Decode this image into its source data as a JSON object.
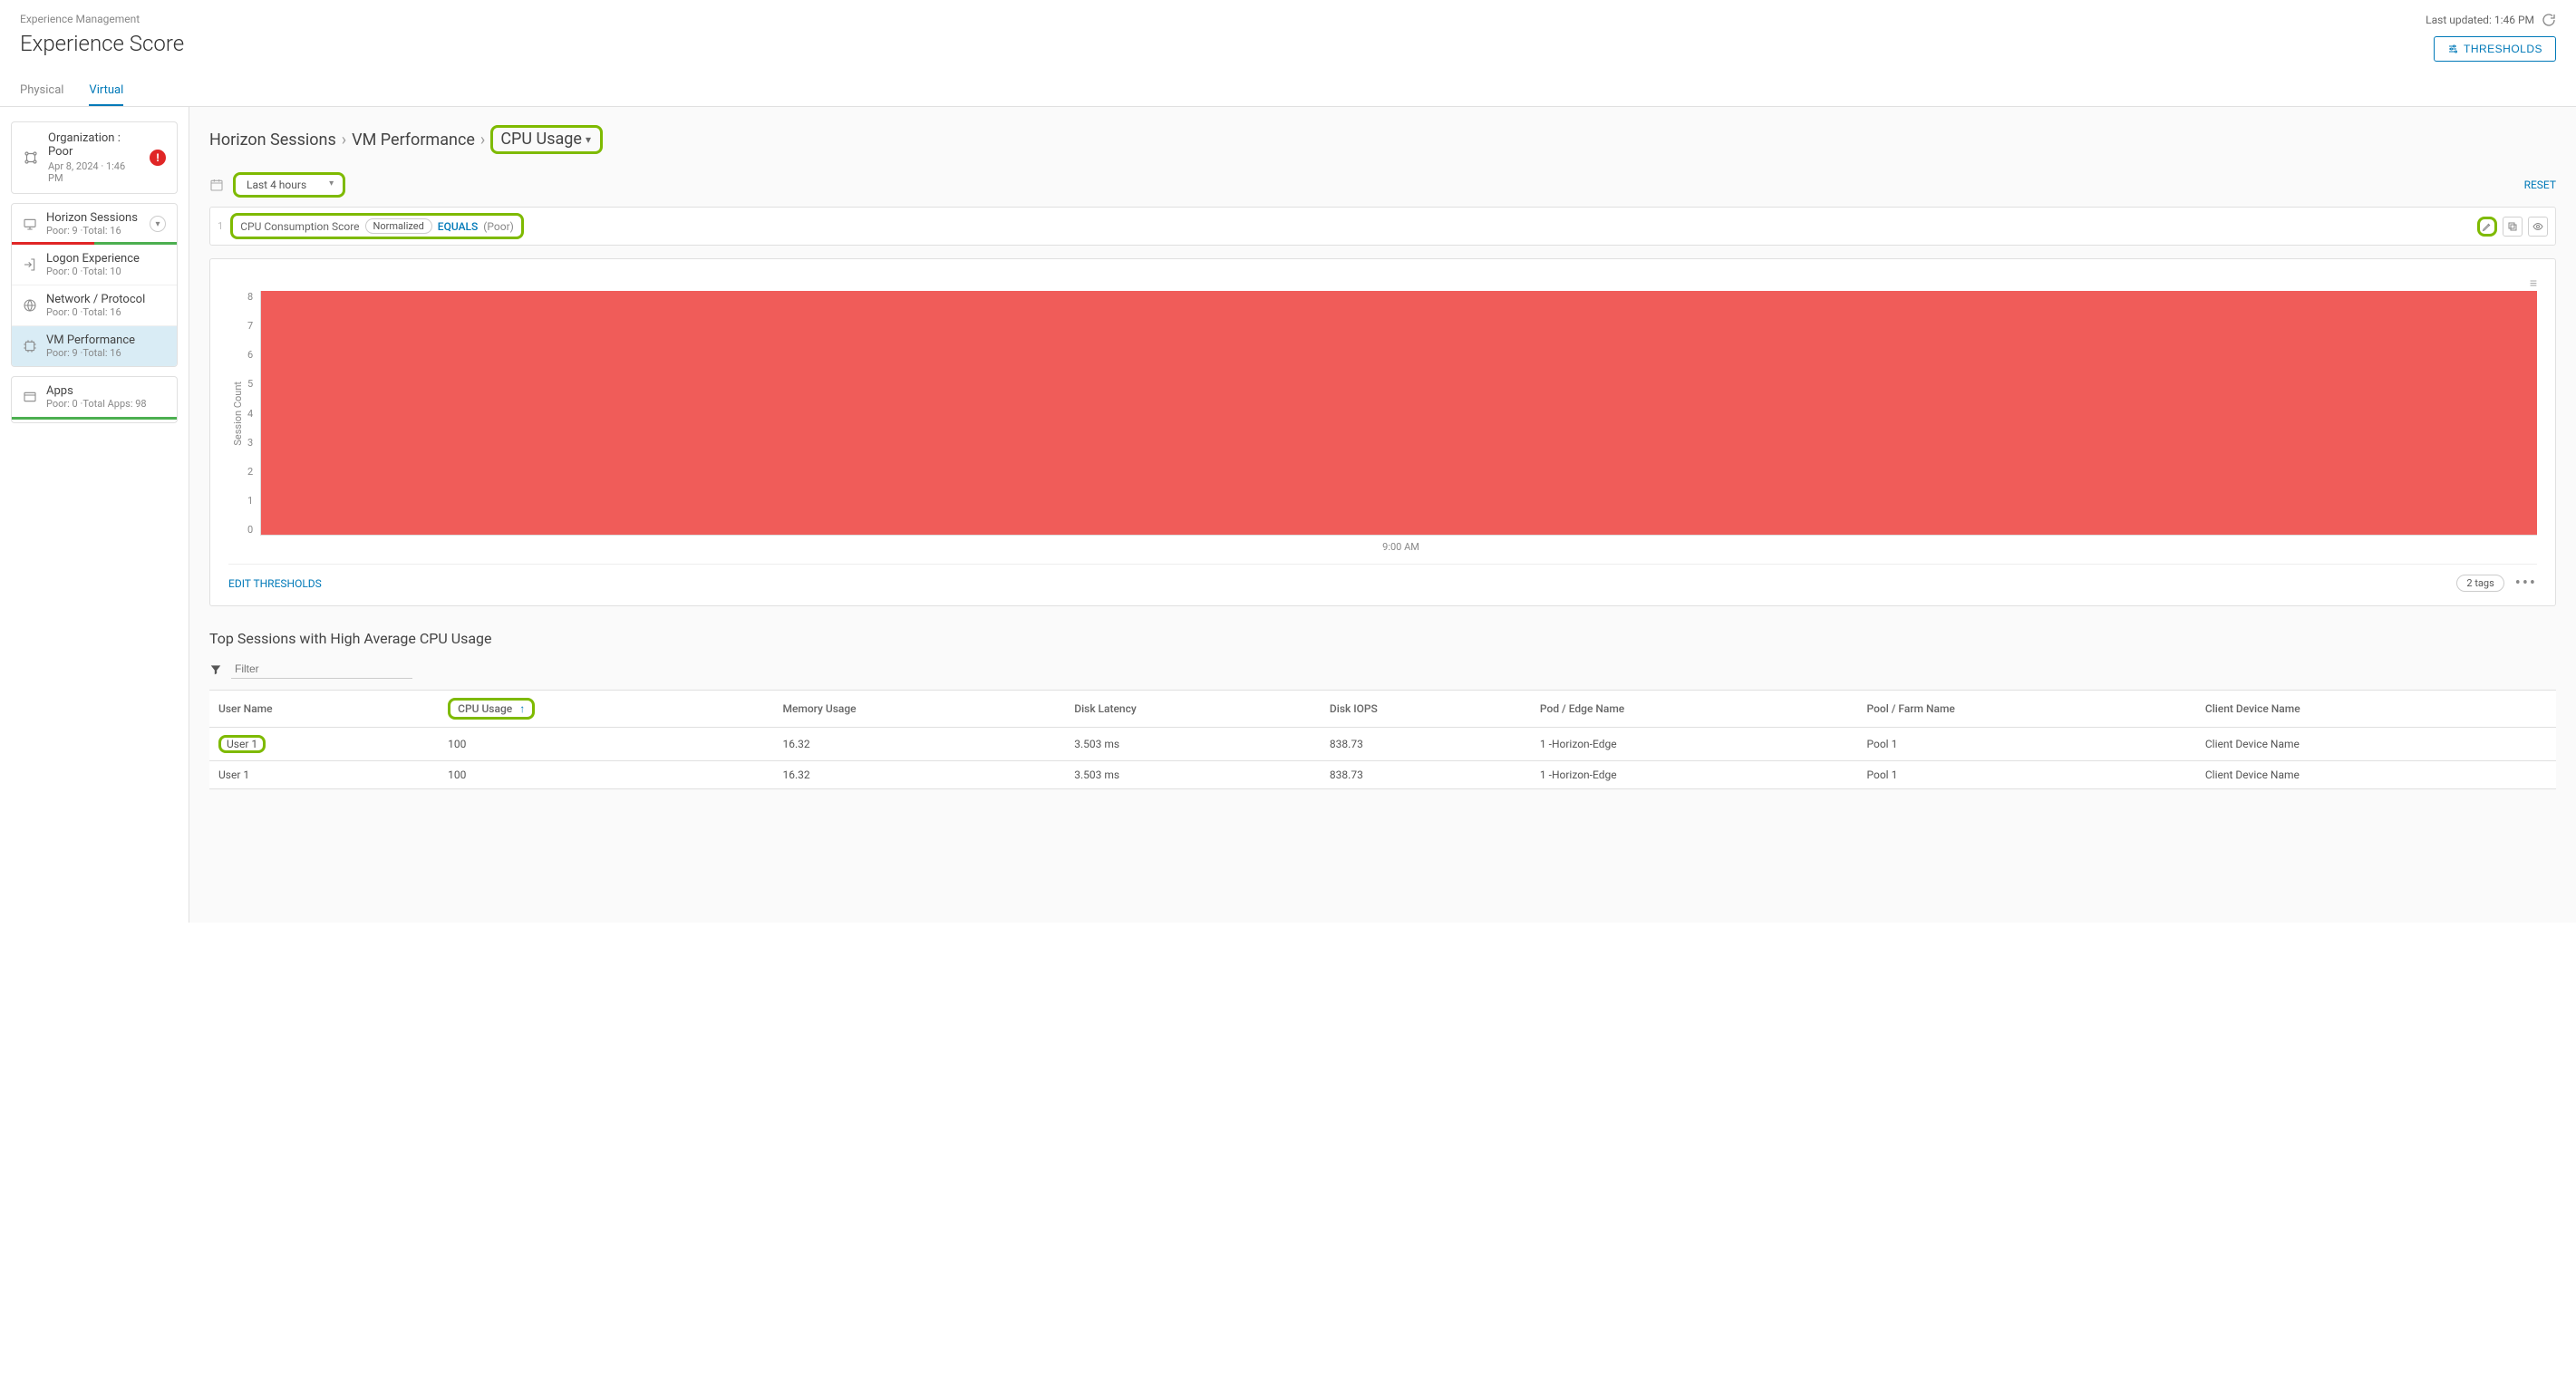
{
  "header": {
    "app_breadcrumb": "Experience Management",
    "title": "Experience Score",
    "last_updated_label": "Last updated: 1:46 PM",
    "thresholds_btn": "THRESHOLDS"
  },
  "tabs": {
    "physical": "Physical",
    "virtual": "Virtual"
  },
  "sidebar": {
    "org": {
      "title": "Organization : Poor",
      "sub": "Apr 8, 2024 · 1:46 PM",
      "badge": "!"
    },
    "horizon": {
      "title": "Horizon Sessions",
      "sub": "Poor: 9 ·Total: 16"
    },
    "logon": {
      "title": "Logon Experience",
      "sub": "Poor: 0 ·Total: 10"
    },
    "network": {
      "title": "Network / Protocol",
      "sub": "Poor: 0 ·Total: 16"
    },
    "vmperf": {
      "title": "VM Performance",
      "sub": "Poor: 9 ·Total: 16"
    },
    "apps": {
      "title": "Apps",
      "sub": "Poor: 0 ·Total Apps: 98"
    }
  },
  "breadcrumbs": {
    "a": "Horizon Sessions",
    "b": "VM Performance",
    "c": "CPU Usage"
  },
  "controls": {
    "time_range": "Last 4 hours",
    "reset": "RESET",
    "filter_num": "1",
    "filter_label": "CPU Consumption Score",
    "filter_norm": "Normalized",
    "filter_eq": "EQUALS",
    "filter_val": "(Poor)"
  },
  "chart_data": {
    "type": "area",
    "ylabel": "Session Count",
    "xlabel": "",
    "ylim": [
      0,
      8
    ],
    "yticks": [
      "0",
      "1",
      "2",
      "3",
      "4",
      "5",
      "6",
      "7",
      "8"
    ],
    "xticks": [
      "9:00 AM"
    ],
    "series": [
      {
        "name": "Poor",
        "color": "#ef5350",
        "value_constant": 8
      }
    ],
    "footer": {
      "edit_thresholds": "EDIT THRESHOLDS",
      "tags_pill": "2 tags"
    }
  },
  "sessions": {
    "title": "Top Sessions with High Average CPU Usage",
    "filter_placeholder": "Filter",
    "columns": {
      "user": "User Name",
      "cpu": "CPU Usage",
      "mem": "Memory Usage",
      "disk_lat": "Disk Latency",
      "disk_iops": "Disk IOPS",
      "pod": "Pod / Edge Name",
      "pool": "Pool / Farm Name",
      "client": "Client Device Name"
    },
    "rows": [
      {
        "user": "User 1",
        "cpu": "100",
        "mem": "16.32",
        "disk_lat": "3.503 ms",
        "disk_iops": "838.73",
        "pod": "1 -Horizon-Edge",
        "pool": "Pool 1",
        "client": "Client Device Name"
      },
      {
        "user": "User 1",
        "cpu": "100",
        "mem": "16.32",
        "disk_lat": "3.503 ms",
        "disk_iops": "838.73",
        "pod": "1 -Horizon-Edge",
        "pool": "Pool 1",
        "client": "Client Device Name"
      }
    ]
  }
}
